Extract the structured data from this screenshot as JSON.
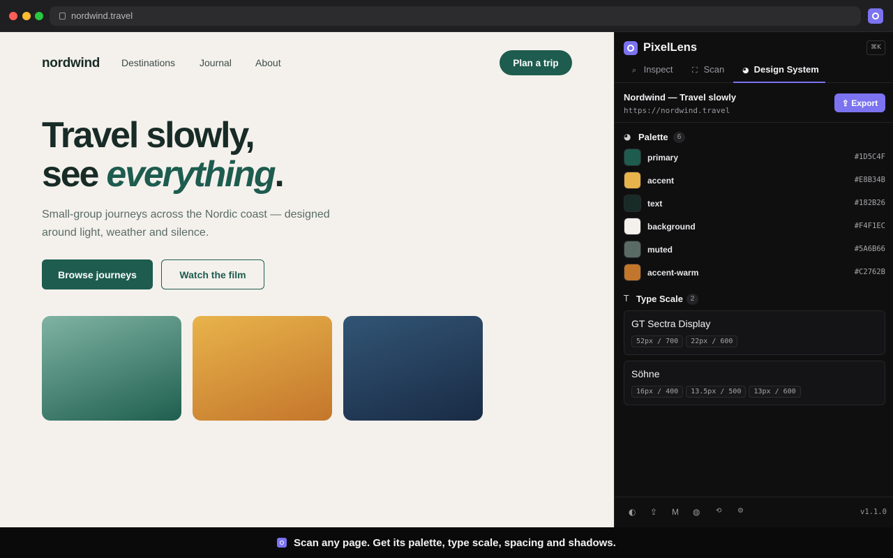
{
  "browser": {
    "url": "nordwind.travel"
  },
  "site": {
    "logo": "nordwind",
    "nav": [
      "Destinations",
      "Journal",
      "About"
    ],
    "cta": "Plan a trip",
    "hero": {
      "line1": "Travel slowly,",
      "line2_prefix": "see ",
      "line2_em": "everything",
      "line2_suffix": ".",
      "subtitle": "Small-group journeys across the Nordic coast — designed around light, weather and silence.",
      "primary_button": "Browse journeys",
      "secondary_button": "Watch the film"
    }
  },
  "panel": {
    "title": "PixelLens",
    "shortcut": "⌘K",
    "tabs": [
      {
        "label": "Inspect",
        "icon": "search-icon"
      },
      {
        "label": "Scan",
        "icon": "scan-icon"
      },
      {
        "label": "Design System",
        "icon": "palette-icon",
        "active": true
      }
    ],
    "site_title": "Nordwind — Travel slowly",
    "site_url": "https://nordwind.travel",
    "export_label": "Export",
    "palette": {
      "title": "Palette",
      "count": "6",
      "colors": [
        {
          "name": "primary",
          "hex": "#1D5C4F"
        },
        {
          "name": "accent",
          "hex": "#E8B34B"
        },
        {
          "name": "text",
          "hex": "#182B26"
        },
        {
          "name": "background",
          "hex": "#F4F1EC"
        },
        {
          "name": "muted",
          "hex": "#5A6B66"
        },
        {
          "name": "accent-warm",
          "hex": "#C2762B"
        }
      ]
    },
    "type_scale": {
      "title": "Type Scale",
      "count": "2",
      "fonts": [
        {
          "name": "GT Sectra Display",
          "sizes": [
            "52px / 700",
            "22px / 600"
          ]
        },
        {
          "name": "Söhne",
          "sizes": [
            "16px / 400",
            "13.5px / 500",
            "13px / 600"
          ]
        }
      ]
    },
    "footer": {
      "icons": [
        "contrast-icon",
        "share-icon",
        "m-icon",
        "globe-icon",
        "history-icon",
        "settings-icon"
      ],
      "version": "v1.1.0"
    }
  },
  "banner": {
    "text": "Scan any page. Get its palette, type scale, spacing and shadows."
  }
}
